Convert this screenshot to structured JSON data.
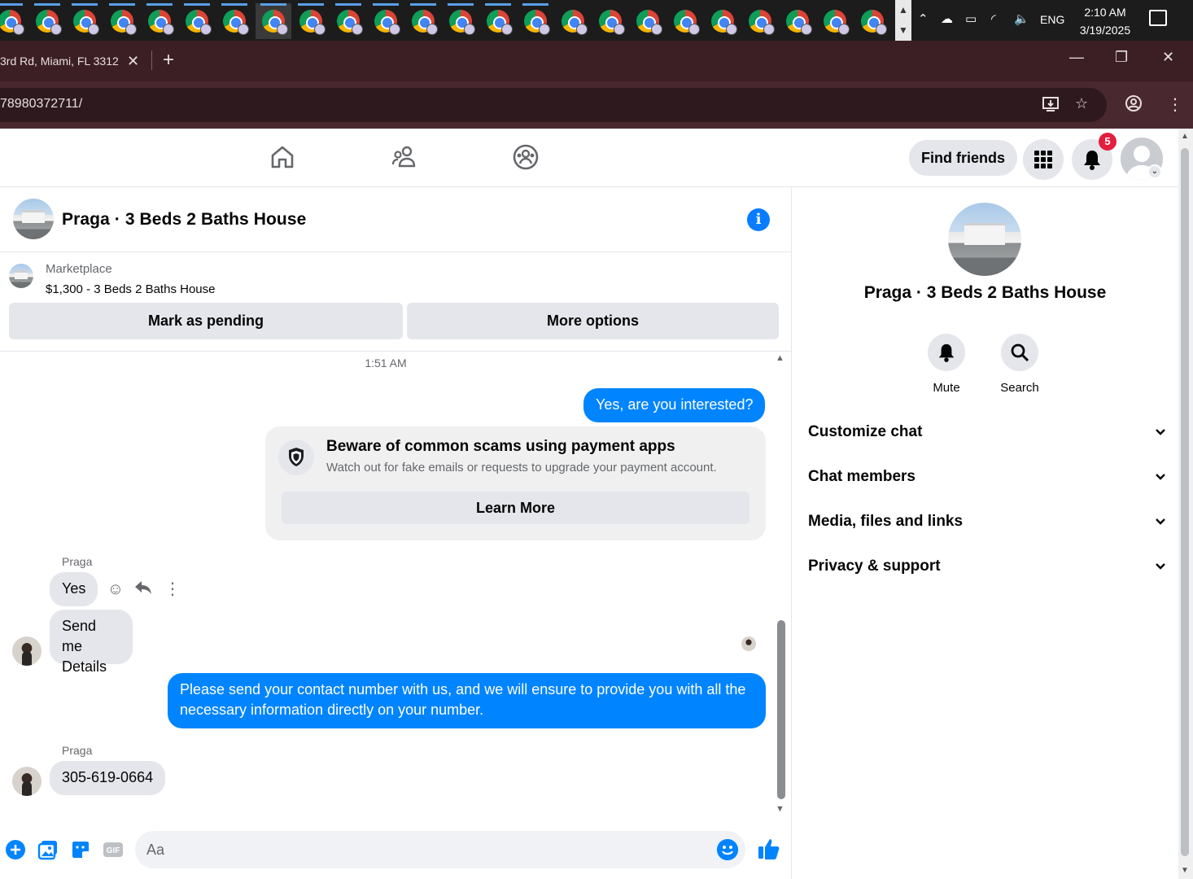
{
  "taskbar": {
    "language": "ENG",
    "time": "2:10 AM",
    "date": "3/19/2025",
    "scroll_up": "▲",
    "scroll_down": "▼"
  },
  "browser": {
    "tab_title": "3rd Rd, Miami, FL 3312",
    "tab_close": "✕",
    "new_tab": "+",
    "url": "78980372711/",
    "minimize": "—",
    "maximize": "❐",
    "close": "✕",
    "install_icon": "install-app-icon",
    "bookmark_icon": "star-icon"
  },
  "nav": {
    "find_friends": "Find friends",
    "notification_count": "5"
  },
  "chat": {
    "title": "Praga · 3 Beds 2 Baths House",
    "marketplace_label": "Marketplace",
    "listing": "$1,300 - 3 Beds 2 Baths House",
    "mark_pending": "Mark as pending",
    "more_options": "More options",
    "timestamp": "1:51 AM",
    "messages": {
      "m1": "Yes, are you interested?",
      "scam_title": "Beware of common scams using payment apps",
      "scam_sub": "Watch out for fake emails or requests to upgrade your payment account.",
      "learn_more": "Learn More",
      "sender1": "Praga",
      "m2": "Yes",
      "m3": "Send me Details",
      "m4": "Please send your contact number with us, and we will ensure to provide you with all the necessary information directly on your number.",
      "sender2": "Praga",
      "m5": "305-619-0664"
    },
    "composer_placeholder": "Aa"
  },
  "panel": {
    "title": "Praga · 3 Beds 2 Baths House",
    "mute": "Mute",
    "search": "Search",
    "sections": [
      "Customize chat",
      "Chat members",
      "Media, files and links",
      "Privacy & support"
    ]
  },
  "colors": {
    "accent": "#0084ff",
    "tab_bg": "#3c1f25",
    "badge": "#e41e3f"
  }
}
